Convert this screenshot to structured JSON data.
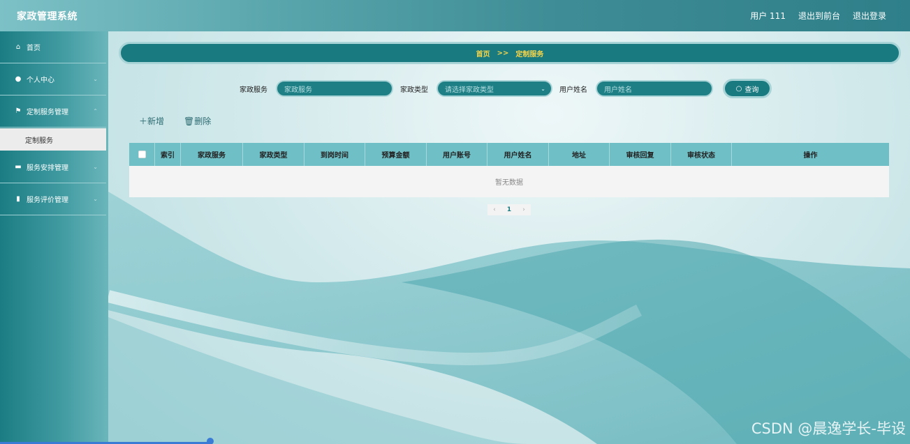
{
  "header": {
    "title": "家政管理系统",
    "user": "用户 111",
    "to_frontend": "退出到前台",
    "logout": "退出登录"
  },
  "sidebar": {
    "items": [
      {
        "label": "首页",
        "icon": "home-icon"
      },
      {
        "label": "个人中心",
        "icon": "user-icon"
      },
      {
        "label": "定制服务管理",
        "icon": "flag-icon"
      },
      {
        "label": "定制服务",
        "icon": ""
      },
      {
        "label": "服务安排管理",
        "icon": "briefcase-icon"
      },
      {
        "label": "服务评价管理",
        "icon": "clipboard-icon"
      }
    ]
  },
  "breadcrumb": {
    "home": "首页",
    "sep": ">>",
    "current": "定制服务"
  },
  "search": {
    "service_label": "家政服务",
    "service_placeholder": "家政服务",
    "type_label": "家政类型",
    "type_placeholder": "请选择家政类型",
    "username_label": "用户姓名",
    "username_placeholder": "用户姓名",
    "query_button": "查询"
  },
  "actions": {
    "add": "新增",
    "delete": "删除"
  },
  "table": {
    "columns": [
      "索引",
      "家政服务",
      "家政类型",
      "到岗时间",
      "预算金额",
      "用户账号",
      "用户姓名",
      "地址",
      "审核回复",
      "审核状态",
      "操作"
    ],
    "empty_text": "暂无数据"
  },
  "pager": {
    "current": "1"
  },
  "watermark": "CSDN @晨逸学长-毕设",
  "colors": {
    "accent": "#197a80",
    "breadcrumb_text": "#f6d44a",
    "table_header": "#6fbfc6"
  }
}
